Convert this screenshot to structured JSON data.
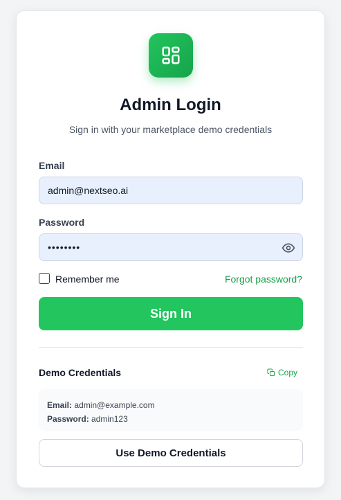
{
  "header": {
    "logo_icon": "dashboard-grid-icon",
    "title": "Admin Login",
    "subtitle": "Sign in with your marketplace demo credentials"
  },
  "form": {
    "email_label": "Email",
    "email_value": "admin@nextseo.ai",
    "password_label": "Password",
    "password_mask": "••••••••",
    "remember_label": "Remember me",
    "remember_checked": false,
    "forgot_label": "Forgot password?",
    "submit_label": "Sign In"
  },
  "demo": {
    "title": "Demo Credentials",
    "copy_label": "Copy",
    "email_key": "Email:",
    "email_value": "admin@example.com",
    "password_key": "Password:",
    "password_value": "admin123",
    "use_button_label": "Use Demo Credentials"
  },
  "colors": {
    "accent": "#22c55e",
    "accent_dark": "#16a34a",
    "input_bg": "#e8f0fe"
  }
}
